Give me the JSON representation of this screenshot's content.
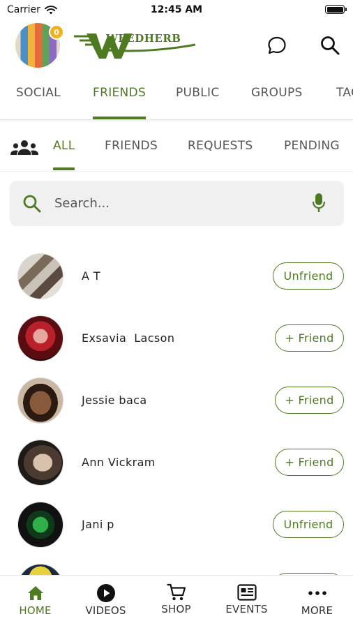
{
  "status_bar": {
    "carrier": "Carrier",
    "time": "12:45 AM"
  },
  "header": {
    "notification_count": "0",
    "logo_text": "WEEDHERB"
  },
  "main_tabs": [
    {
      "label": "SOCIAL",
      "active": false
    },
    {
      "label": "FRIENDS",
      "active": true
    },
    {
      "label": "PUBLIC",
      "active": false
    },
    {
      "label": "GROUPS",
      "active": false
    },
    {
      "label": "TAG",
      "active": false
    }
  ],
  "sub_tabs": [
    {
      "label": "ALL",
      "active": true
    },
    {
      "label": "FRIENDS",
      "active": false
    },
    {
      "label": "REQUESTS",
      "active": false
    },
    {
      "label": "PENDING",
      "active": false
    }
  ],
  "search": {
    "placeholder": "Search..."
  },
  "friends": [
    {
      "name": "A T",
      "action": "Unfriend"
    },
    {
      "name": "Exsavia  Lacson",
      "action": "+ Friend"
    },
    {
      "name": "Jessie baca",
      "action": "+ Friend"
    },
    {
      "name": "Ann Vickram",
      "action": "+ Friend"
    },
    {
      "name": "Jani p",
      "action": "Unfriend"
    },
    {
      "name": "",
      "action": ""
    }
  ],
  "bottom_nav": [
    {
      "label": "HOME",
      "icon": "home-icon",
      "active": true
    },
    {
      "label": "VIDEOS",
      "icon": "play-circle-icon",
      "active": false
    },
    {
      "label": "SHOP",
      "icon": "cart-icon",
      "active": false
    },
    {
      "label": "EVENTS",
      "icon": "events-icon",
      "active": false
    },
    {
      "label": "MORE",
      "icon": "more-dots-icon",
      "active": false
    }
  ],
  "colors": {
    "accent": "#4e7a21",
    "badge": "#f2b01e",
    "search_bg": "#f0f0f0"
  }
}
